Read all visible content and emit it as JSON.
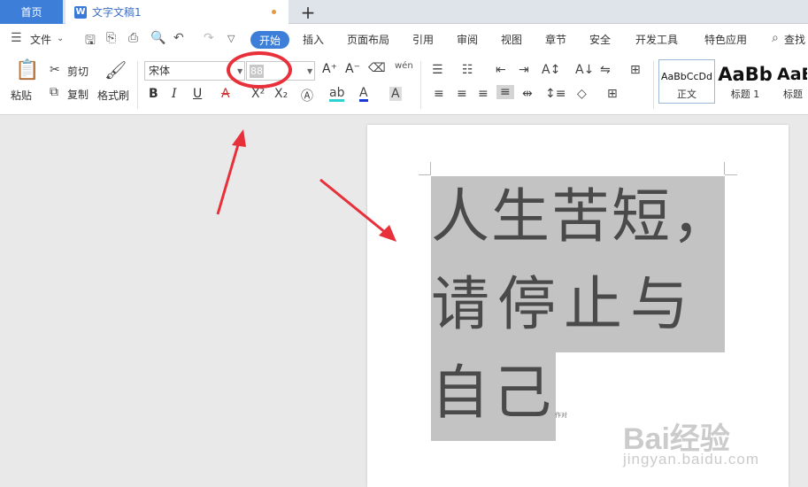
{
  "tabs": {
    "home": "首页",
    "doc_title": "文字文稿1",
    "doc_icon": "W",
    "new_tab": "+"
  },
  "menu": {
    "file": "文件",
    "items": [
      "开始",
      "插入",
      "页面布局",
      "引用",
      "审阅",
      "视图",
      "章节",
      "安全",
      "开发工具",
      "特色应用"
    ],
    "search": "查找"
  },
  "ribbon": {
    "paste": "粘贴",
    "cut": "剪切",
    "copy": "复制",
    "format_painter": "格式刷",
    "font_name": "宋体",
    "font_size": "88",
    "grow_font": "A⁺",
    "shrink_font": "A⁻",
    "bold": "B",
    "italic": "I",
    "underline": "U",
    "pinyin": "wén",
    "styles": [
      {
        "sample": "AaBbCcDd",
        "label": "正文"
      },
      {
        "sample": "AaBb",
        "label": "标题 1"
      },
      {
        "sample": "AaE",
        "label": "标题"
      }
    ]
  },
  "document": {
    "lines": [
      "人生苦短，",
      "请 停 止 与",
      "自己"
    ],
    "tiny_note": "作对"
  },
  "watermark": {
    "brand": "Bai经验",
    "url": "jingyan.baidu.com"
  },
  "colors": {
    "accent": "#3d7fd8",
    "annotation": "#e8303a",
    "selection": "#c3c3c3"
  }
}
